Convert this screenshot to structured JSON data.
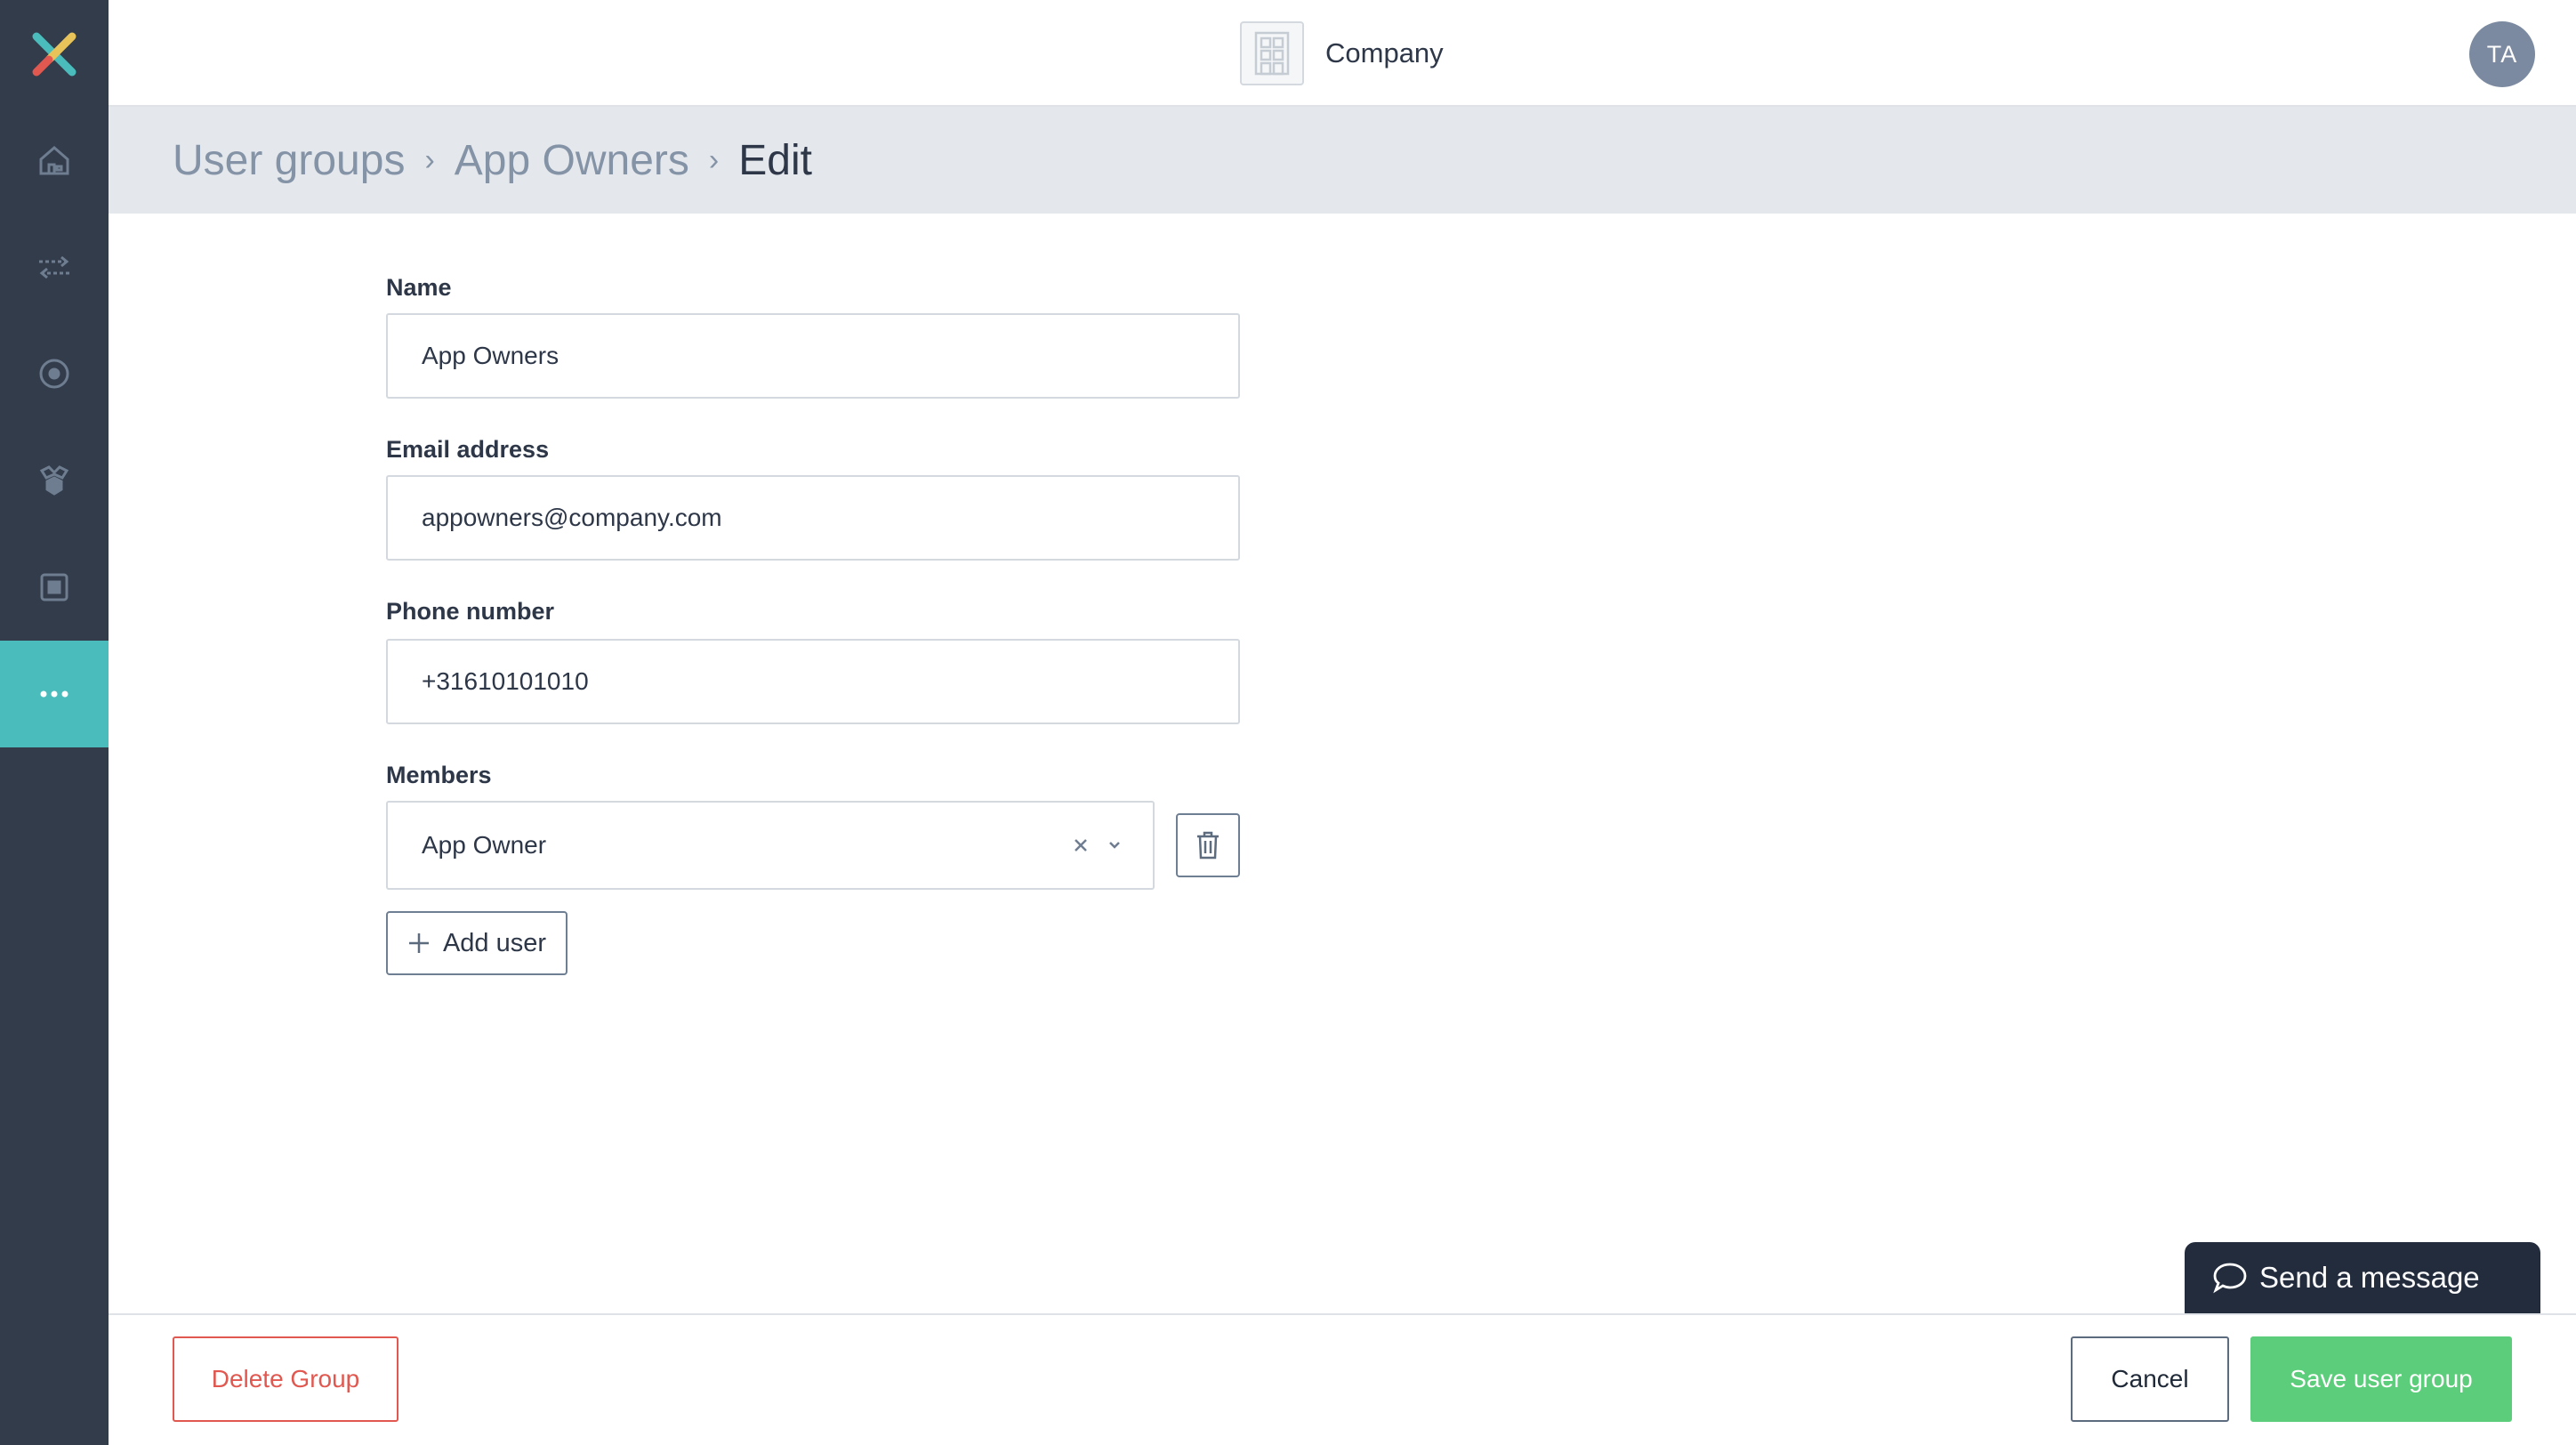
{
  "topbar": {
    "company_name": "Company",
    "avatar_initials": "TA"
  },
  "sidebar": {
    "items": [
      {
        "icon": "home-icon"
      },
      {
        "icon": "transfer-arrows-icon"
      },
      {
        "icon": "target-icon"
      },
      {
        "icon": "integrations-icon"
      },
      {
        "icon": "device-icon"
      },
      {
        "icon": "more-icon",
        "active": true
      }
    ]
  },
  "breadcrumb": {
    "items": [
      "User groups",
      "App Owners",
      "Edit"
    ],
    "separator": "›"
  },
  "form": {
    "name_label": "Name",
    "name_value": "App Owners",
    "email_label": "Email address",
    "email_value": "appowners@company.com",
    "phone_label": "Phone number",
    "phone_value": "+31610101010",
    "members_label": "Members",
    "member_value": "App Owner",
    "add_user_label": "Add user"
  },
  "footer": {
    "delete_label": "Delete Group",
    "cancel_label": "Cancel",
    "save_label": "Save user group"
  },
  "chat": {
    "label": "Send a message"
  },
  "colors": {
    "sidebar_bg": "#323c4b",
    "sidebar_active": "#4bbcbc",
    "delete": "#e0584f",
    "save": "#5ccd7a",
    "chat_bg": "#232c3d"
  }
}
